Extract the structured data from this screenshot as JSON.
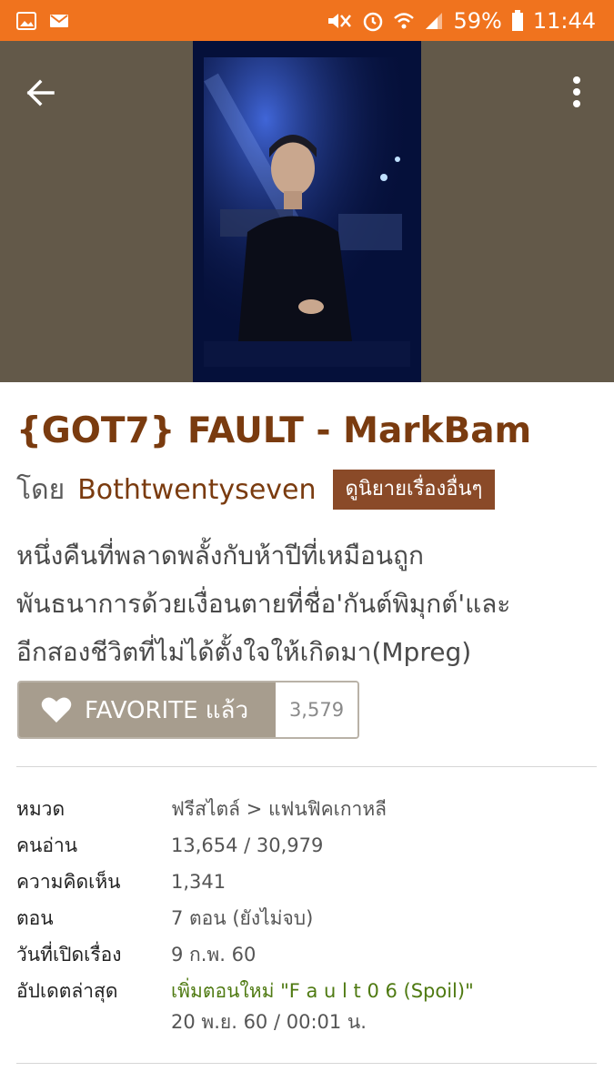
{
  "status_bar": {
    "battery": "59%",
    "time": "11:44",
    "icons": [
      "image-icon",
      "mail-icon",
      "mute-icon",
      "alarm-icon",
      "wifi-icon",
      "signal-icon",
      "battery-icon"
    ]
  },
  "header": {
    "back_icon": "arrow-left-icon",
    "menu_icon": "more-vertical-icon"
  },
  "story": {
    "title": "{GOT7} FAULT - MarkBam",
    "by_label": "โดย",
    "author": "Bothtwentyseven",
    "more_stories_label": "ดูนิยายเรื่องอื่นๆ",
    "description_lines": [
      "หนึ่งคืนที่พลาดพลั้งกับห้าปีที่เหมือนถูก",
      "พันธนาการด้วยเงื่อนตายที่ชื่อ'กันต์พิมุกต์'และ",
      "อีกสองชีวิตที่ไม่ได้ตั้งใจให้เกิดมา(Mpreg)"
    ]
  },
  "favorite": {
    "label": "FAVORITE แล้ว",
    "count": "3,579",
    "icon": "heart-icon"
  },
  "info": [
    {
      "label": "หมวด",
      "value": "ฟรีสไตล์ > แฟนฟิคเกาหลี"
    },
    {
      "label": "คนอ่าน",
      "value": "13,654 / 30,979"
    },
    {
      "label": "ความคิดเห็น",
      "value": "1,341"
    },
    {
      "label": "ตอน",
      "value": "7 ตอน (ยังไม่จบ)"
    },
    {
      "label": "วันที่เปิดเรื่อง",
      "value": "9 ก.พ. 60"
    },
    {
      "label": "อัปเดตล่าสุด",
      "value": "เพิ่มตอนใหม่ \"F a u l t 0 6 (Spoil)\"",
      "value2": "20 พ.ย. 60 / 00:01 น."
    }
  ],
  "colors": {
    "status_bar": "#f0731e",
    "hero_bg": "#635949",
    "title": "#7a3b0f",
    "button_bg": "#8a4a28",
    "favorite_bg": "#a79d8e",
    "update_green": "#4f7a12"
  }
}
